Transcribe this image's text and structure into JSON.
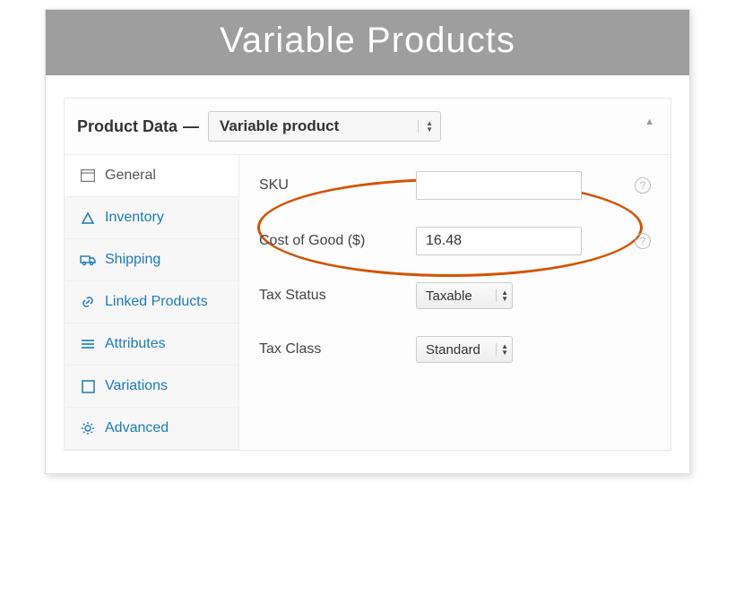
{
  "banner": {
    "title": "Variable Products"
  },
  "panel": {
    "title": "Product Data",
    "dash": "—",
    "product_type": "Variable product"
  },
  "sidebar": {
    "general": "General",
    "inventory": "Inventory",
    "shipping": "Shipping",
    "linked": "Linked Products",
    "attributes": "Attributes",
    "variations": "Variations",
    "advanced": "Advanced"
  },
  "fields": {
    "sku_label": "SKU",
    "sku_value": "",
    "cog_label": "Cost of Good ($)",
    "cog_value": "16.48",
    "tax_status_label": "Tax Status",
    "tax_status_value": "Taxable",
    "tax_class_label": "Tax Class",
    "tax_class_value": "Standard"
  },
  "help": "?"
}
